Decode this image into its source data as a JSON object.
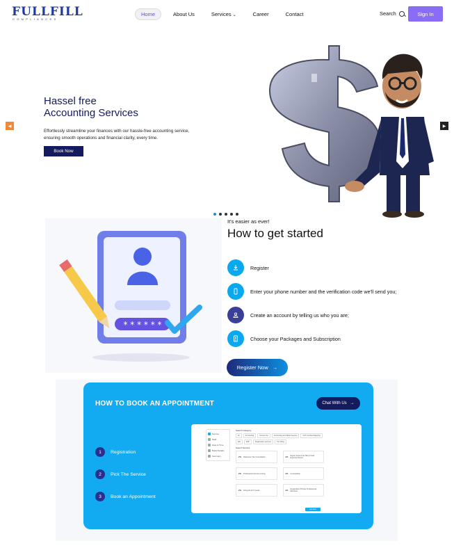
{
  "header": {
    "logo_main": "FULLFILL",
    "logo_sub": "COMPLIANCES",
    "nav": [
      {
        "label": "Home",
        "active": true
      },
      {
        "label": "About Us"
      },
      {
        "label": "Services",
        "has_dropdown": true
      },
      {
        "label": "Career"
      },
      {
        "label": "Contact"
      }
    ],
    "search_label": "Search",
    "sign_in_label": "Sign In",
    "accent_color": "#8b6cf6"
  },
  "hero": {
    "title_line1": "Hassel free",
    "title_line2": "Accounting Services",
    "description": "Effortlessly streamline your finances with our hassle-free accounting service, ensuring smooth operations and financial clarity, every time.",
    "button_label": "Book Now",
    "slide_count": 5,
    "active_slide": 1
  },
  "get_started": {
    "eyebrow": "It's easier as ever!",
    "title": "How to get started",
    "steps": [
      {
        "label": "Register",
        "icon": "download-icon"
      },
      {
        "label": "Enter your phone number and the verification code we'll send you;",
        "icon": "phone-icon"
      },
      {
        "label": "Create an account by telling us who you are;",
        "icon": "user-icon"
      },
      {
        "label": "Choose your Packages and Subscription",
        "icon": "document-icon"
      }
    ],
    "register_label": "Register Now"
  },
  "booking": {
    "title": "HOW TO BOOK AN APPOINTMENT",
    "chat_label": "Chat With Us",
    "steps": [
      {
        "num": "1",
        "label": "Registration"
      },
      {
        "num": "2",
        "label": "Pick The Service"
      },
      {
        "num": "3",
        "label": "Book an Appointment"
      }
    ],
    "bg_color": "#12aaf0",
    "mock": {
      "side_items": [
        "Service",
        "Staff",
        "Date & Time",
        "Basic Details",
        "Summary"
      ],
      "category_heading": "Search Category",
      "tags": [
        "All",
        "Accounting",
        "Income Tax",
        "Accounting and Book Keeping",
        "GST Certified Mapping",
        "ESI",
        "EPF",
        "Registration services",
        "Tax Filing"
      ],
      "service_heading": "Search Service",
      "cards": [
        {
          "abbr": "ZA",
          "label": "Reference Tax Consultation"
        },
        {
          "abbr": "ZA",
          "label": "Expert Income tax filing Travel Expense Return"
        },
        {
          "abbr": "ZA",
          "label": "Professional Income Listing"
        },
        {
          "abbr": "ZA",
          "label": "Consultation"
        },
        {
          "abbr": "ZA",
          "label": "Filing ZA ACT Guide"
        },
        {
          "abbr": "ZA",
          "label": "Registration Private Professional Members"
        }
      ],
      "next_label": "Get Next"
    }
  }
}
